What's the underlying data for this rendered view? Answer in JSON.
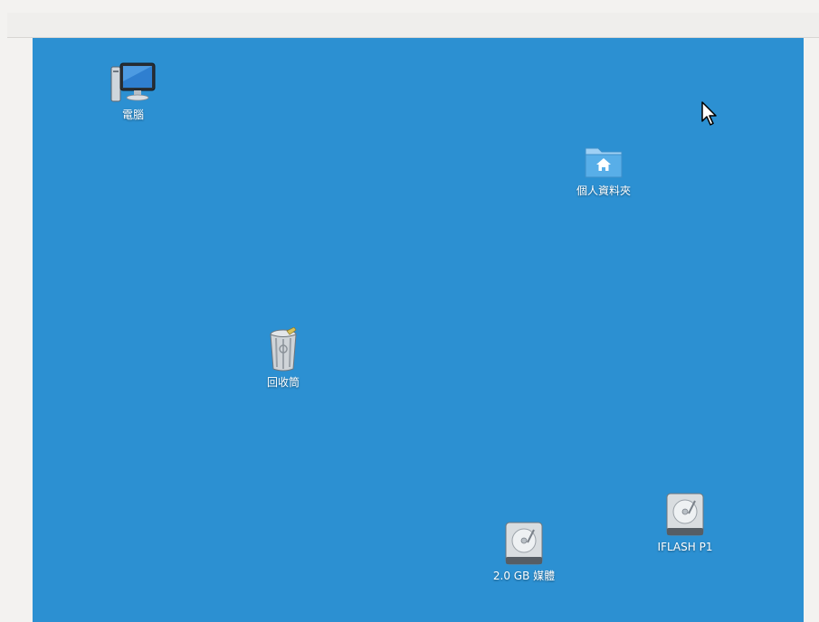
{
  "screen": {
    "desktop_color": "#2c90d2",
    "frame_color": "#f1f0ee"
  },
  "desktop": {
    "icons": [
      {
        "id": "computer",
        "label": "電腦",
        "icon": "computer-monitor-icon"
      },
      {
        "id": "home",
        "label": "個人資料夾",
        "icon": "home-folder-icon"
      },
      {
        "id": "trash",
        "label": "回收筒",
        "icon": "trash-bin-icon"
      },
      {
        "id": "media",
        "label": "2.0 GB 媒體",
        "icon": "hard-disk-icon"
      },
      {
        "id": "iflash",
        "label": "IFLASH P1",
        "icon": "hard-disk-icon"
      }
    ]
  },
  "cursor": {
    "icon": "mouse-pointer-icon"
  }
}
